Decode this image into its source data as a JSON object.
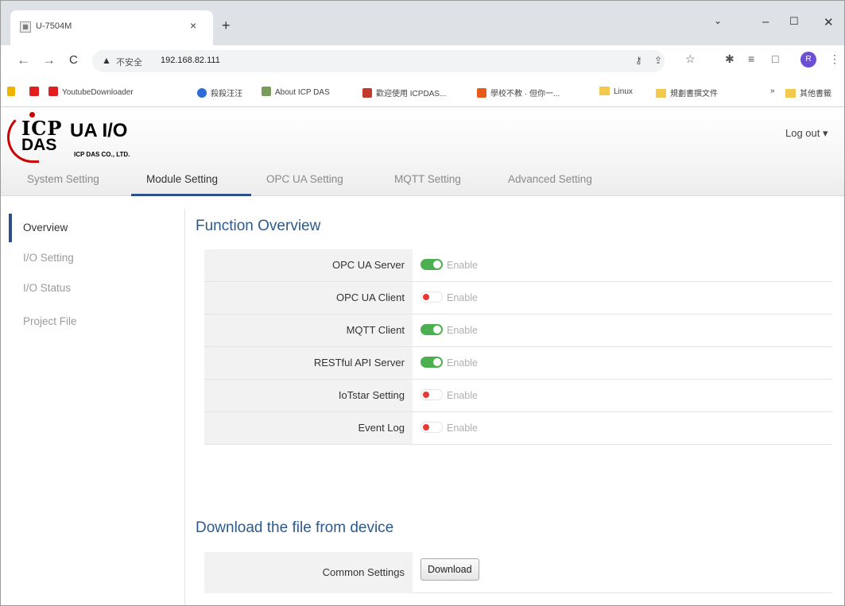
{
  "browser": {
    "tab_title": "U-7504M",
    "tab_favicon": "icp-favicon",
    "insecure_label": "不安全",
    "url": "192.168.82.111",
    "profile_initial": "R"
  },
  "bookmarks": [
    {
      "label": "",
      "icon": "puzzle"
    },
    {
      "label": "",
      "icon": "youtube"
    },
    {
      "label": "YoutubeDownloader",
      "icon": "youtube"
    },
    {
      "label": "殺殺汪汪",
      "icon": "globe"
    },
    {
      "label": "About ICP DAS",
      "icon": "icp"
    },
    {
      "label": "歡迎使用 ICPDAS...",
      "icon": "icp"
    },
    {
      "label": "學校不教 · 但你一...",
      "icon": "bolt"
    },
    {
      "label": "Linux",
      "icon": "folder"
    },
    {
      "label": "規劃書撰文件",
      "icon": "folder"
    },
    {
      "label": "»",
      "icon": ""
    },
    {
      "label": "其他書籤",
      "icon": "folder"
    }
  ],
  "app": {
    "logo_icp": "ICP",
    "logo_das": "DAS",
    "product": "UA I/O",
    "company": "ICP DAS CO., LTD.",
    "logout": "Log out ▾"
  },
  "main_tabs": [
    {
      "label": "System Setting"
    },
    {
      "label": "Module Setting"
    },
    {
      "label": "OPC UA Setting"
    },
    {
      "label": "MQTT Setting"
    },
    {
      "label": "Advanced Setting"
    }
  ],
  "sidebar": [
    {
      "label": "Overview"
    },
    {
      "label": "I/O Setting"
    },
    {
      "label": "I/O Status"
    },
    {
      "label": "Project File"
    }
  ],
  "function_overview": {
    "title": "Function Overview",
    "rows": [
      {
        "label": "OPC UA Server",
        "state": "on",
        "value": "Enable"
      },
      {
        "label": "OPC UA Client",
        "state": "off",
        "value": "Enable"
      },
      {
        "label": "MQTT Client",
        "state": "on",
        "value": "Enable"
      },
      {
        "label": "RESTful API Server",
        "state": "on",
        "value": "Enable"
      },
      {
        "label": "IoTstar Setting",
        "state": "off",
        "value": "Enable"
      },
      {
        "label": "Event Log",
        "state": "off",
        "value": "Enable"
      }
    ]
  },
  "download": {
    "title": "Download the file from device",
    "row_label": "Common Settings",
    "button_label": "Download"
  }
}
